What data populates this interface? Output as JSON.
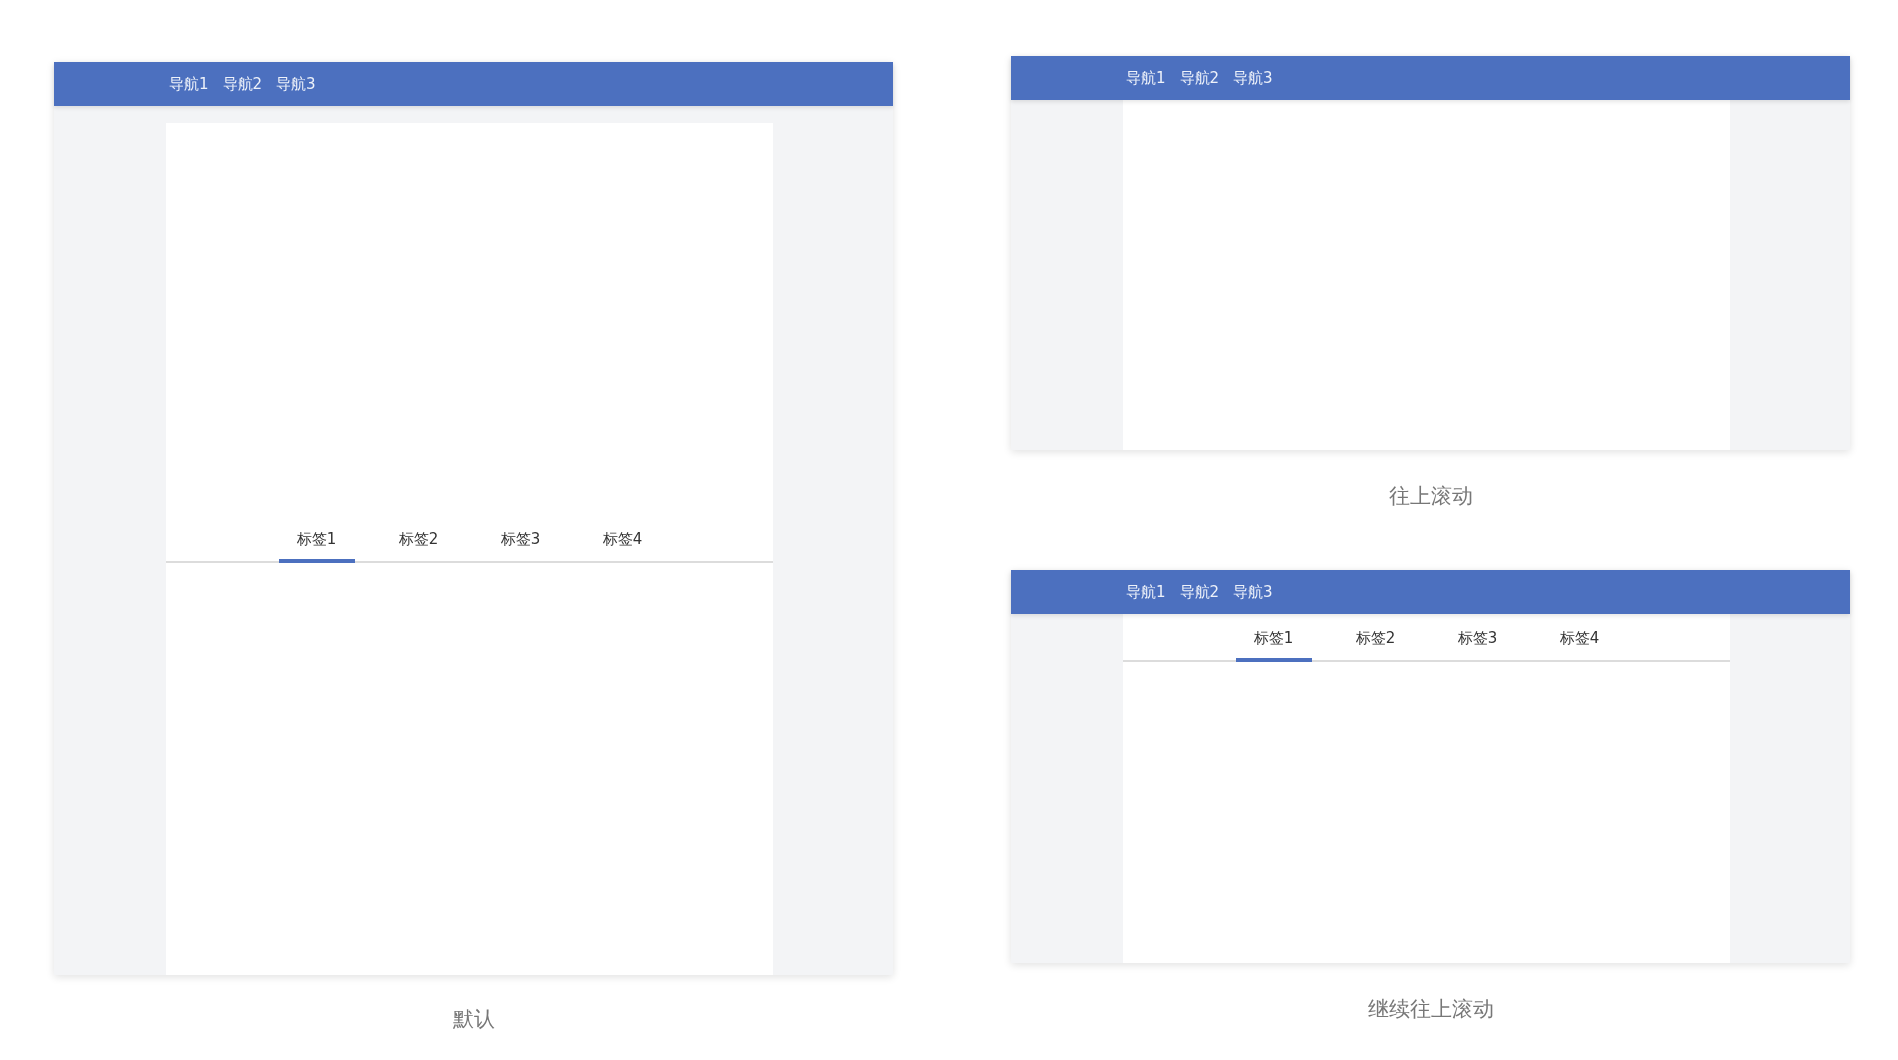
{
  "panels": [
    {
      "kind": "default",
      "nav": [
        "导航1",
        "导航2",
        "导航3"
      ],
      "tabs": [
        {
          "label": "标签1",
          "selected": true
        },
        {
          "label": "标签2",
          "selected": false
        },
        {
          "label": "标签3",
          "selected": false
        },
        {
          "label": "标签4",
          "selected": false
        }
      ],
      "caption": "默认"
    },
    {
      "kind": "scrolled",
      "nav": [
        "导航1",
        "导航2",
        "导航3"
      ],
      "caption": "往上滚动"
    },
    {
      "kind": "sticky",
      "nav": [
        "导航1",
        "导航2",
        "导航3"
      ],
      "tabs": [
        {
          "label": "标签1",
          "selected": true
        },
        {
          "label": "标签2",
          "selected": false
        },
        {
          "label": "标签3",
          "selected": false
        },
        {
          "label": "标签4",
          "selected": false
        }
      ],
      "caption": "继续往上滚动"
    }
  ]
}
